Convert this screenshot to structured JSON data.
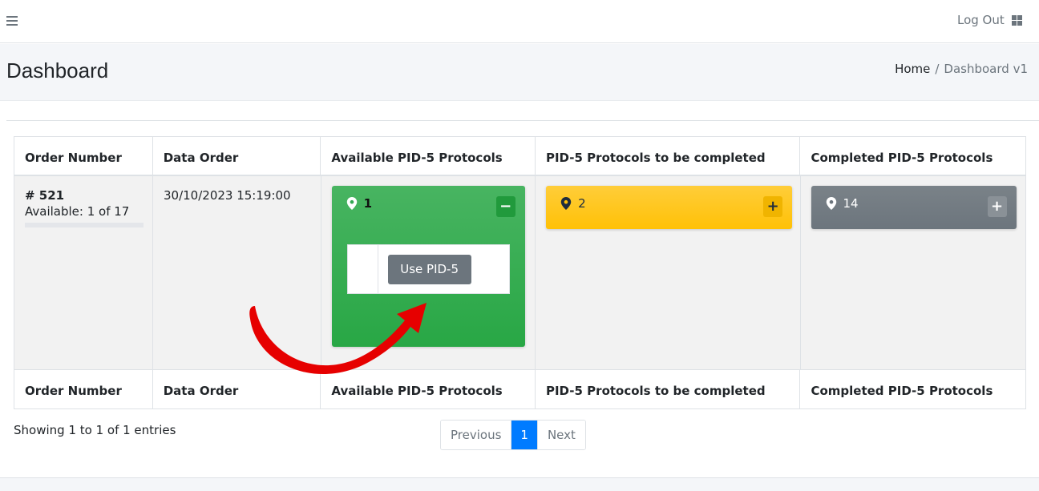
{
  "topbar": {
    "logout_label": "Log Out"
  },
  "header": {
    "title": "Dashboard",
    "breadcrumb_home": "Home",
    "breadcrumb_separator": "/",
    "breadcrumb_active": "Dashboard v1"
  },
  "table": {
    "columns": [
      "Order Number",
      "Data Order",
      "Available PID-5 Protocols",
      "PID-5 Protocols to be completed",
      "Completed PID-5 Protocols"
    ],
    "row": {
      "order_number": "# 521",
      "availability": "Available: 1 of 17",
      "data_order": "30/10/2023 15:19:00",
      "available": {
        "count": "1",
        "toggle": "−",
        "color": "#28a745"
      },
      "to_complete": {
        "count": "2",
        "toggle": "+",
        "color": "#ffc107"
      },
      "completed": {
        "count": "14",
        "toggle": "+",
        "color": "#6c757d"
      },
      "use_button": "Use PID-5"
    }
  },
  "footer": {
    "info": "Showing 1 to 1 of 1 entries",
    "pagination": {
      "previous": "Previous",
      "current": "1",
      "next": "Next"
    }
  },
  "icons": {
    "menu": "hamburger-icon",
    "apps": "grid-icon",
    "marker": "map-marker-icon"
  },
  "annotation": {
    "arrow_color": "#e60000"
  }
}
